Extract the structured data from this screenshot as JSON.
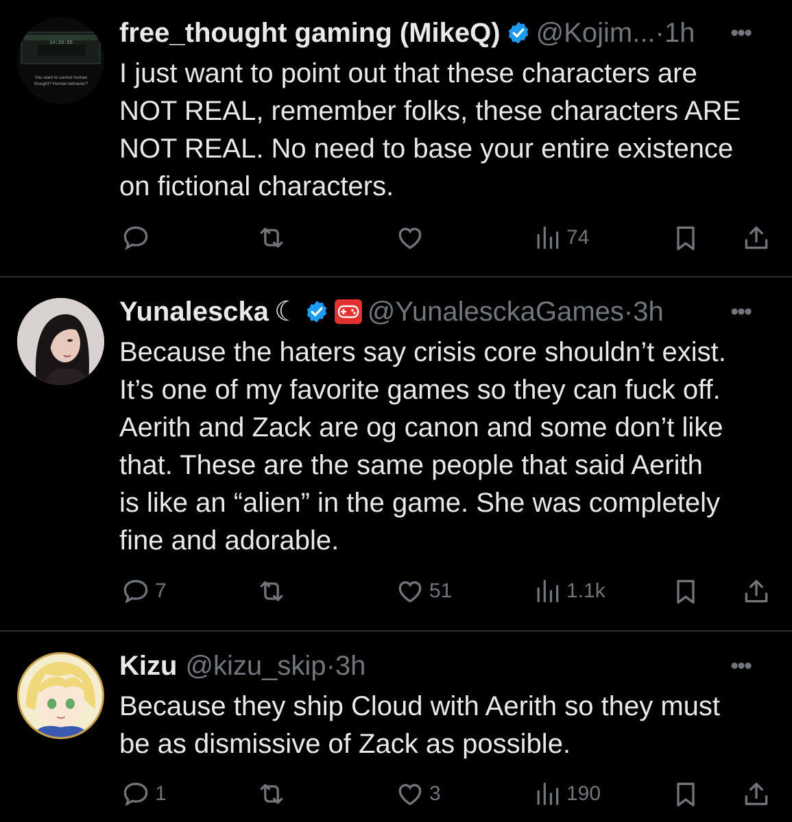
{
  "tweets": [
    {
      "name": "free_thought gaming (MikeQ)",
      "handle": "@Kojim...",
      "dot": " · ",
      "time": "1h",
      "avatar_text_top": "14:20:55",
      "avatar_text_1": "You want to control human",
      "avatar_text_2": "thought? Human behavior?",
      "text_lines": [
        "I just want to point out that these characters are",
        "NOT REAL, remember folks, these characters ARE",
        "NOT REAL. No need to base your entire existence",
        "on fictional characters."
      ],
      "replies": "",
      "retweets": "",
      "likes": "",
      "views": "74"
    },
    {
      "name": "Yunalescka",
      "name_suffix": "☾",
      "handle": "@YunalesckaGames",
      "dot": " · ",
      "time": "3h",
      "text_lines": [
        "Because the haters say crisis core shouldn’t exist.",
        "It’s one of my favorite games so they can fuck off.",
        "Aerith and Zack are og canon and some don’t like",
        "that. These are the same people that said Aerith",
        "is like an “alien” in the game. She was completely",
        "fine and adorable."
      ],
      "replies": "7",
      "retweets": "",
      "likes": "51",
      "views": "1.1k"
    },
    {
      "name": "Kizu",
      "handle": "@kizu_skip",
      "dot": " · ",
      "time": "3h",
      "text_lines": [
        "Because they ship Cloud with Aerith so they must",
        "be as dismissive of Zack as possible."
      ],
      "replies": "1",
      "retweets": "",
      "likes": "3",
      "views": "190"
    }
  ],
  "more_label": "•••",
  "colors": {
    "verified": "#1d9bf0",
    "muted": "#71767b",
    "text": "#e7e9ea",
    "divider": "#2f3336",
    "gamepad": "#e0312e"
  },
  "icons": [
    "reply-icon",
    "retweet-icon",
    "like-icon",
    "views-icon",
    "bookmark-icon",
    "share-icon",
    "verified-icon",
    "more-icon",
    "gamepad-icon"
  ]
}
